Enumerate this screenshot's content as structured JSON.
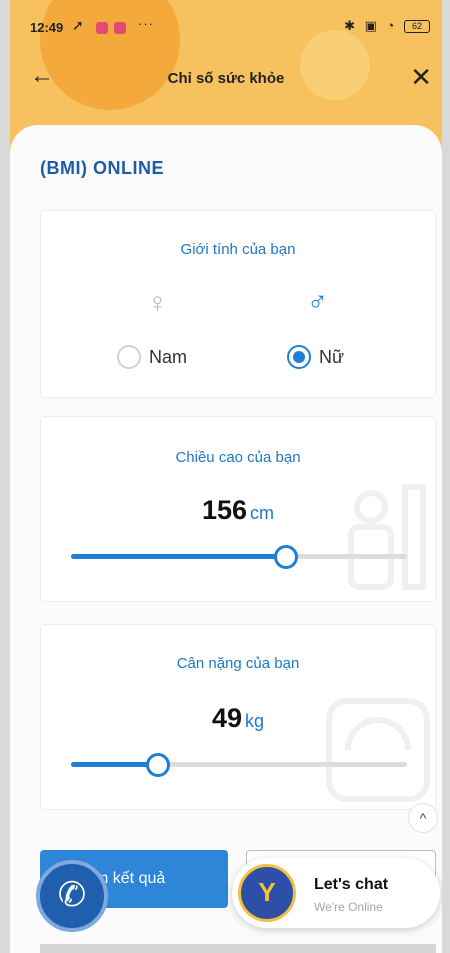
{
  "status_bar": {
    "time": "12:49",
    "more": "···",
    "battery": "62"
  },
  "header": {
    "title": "Chỉ số sức khỏe",
    "back_icon": "arrow-left-icon",
    "close_icon": "close-icon"
  },
  "section": {
    "title": "(BMI) ONLINE"
  },
  "gender": {
    "label": "Giới tính của bạn",
    "options": [
      {
        "label": "Nam",
        "selected": false
      },
      {
        "label": "Nữ",
        "selected": true
      }
    ]
  },
  "height": {
    "label": "Chiều cao của bạn",
    "value": "156",
    "unit": "cm",
    "slider_fraction": 0.64
  },
  "weight": {
    "label": "Cân nặng của bạn",
    "value": "49",
    "unit": "kg",
    "slider_fraction": 0.26
  },
  "actions": {
    "result_label": "m kết quả"
  },
  "chat": {
    "title": "Let's chat",
    "subtitle": "We're Online"
  },
  "colors": {
    "accent": "#1f7fd8",
    "header": "#f7c15f"
  }
}
